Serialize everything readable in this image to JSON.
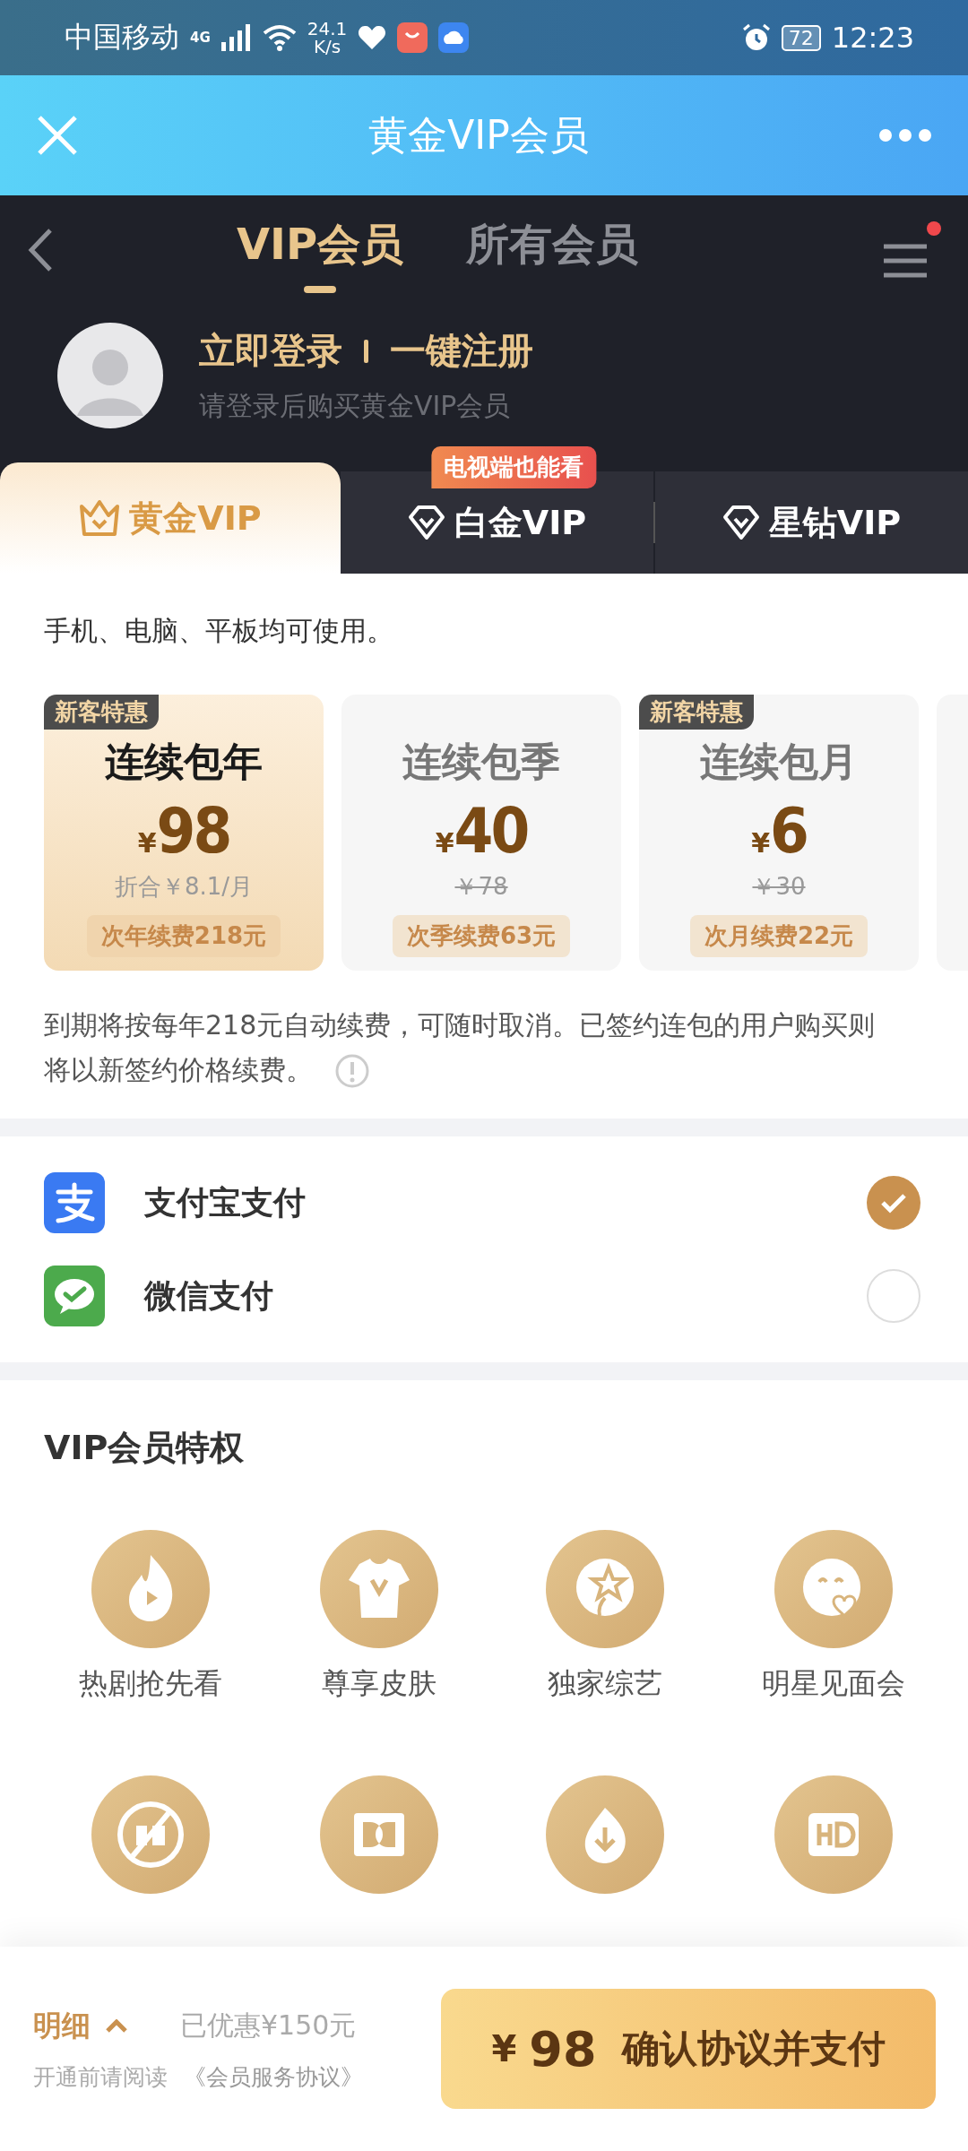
{
  "status_bar": {
    "carrier": "中国移动",
    "network": "4G",
    "speed": "24.1",
    "speed_unit": "K/s",
    "battery": "72",
    "time": "12:23"
  },
  "title_bar": {
    "title": "黄金VIP会员"
  },
  "nav_tabs": [
    {
      "label": "VIP会员",
      "selected": true
    },
    {
      "label": "所有会员",
      "selected": false
    }
  ],
  "login": {
    "login_link": "立即登录",
    "register_link": "一键注册",
    "hint": "请登录后购买黄金VIP会员"
  },
  "tiers": [
    {
      "label": "黄金VIP",
      "kind": "crown",
      "selected": true
    },
    {
      "label": "白金VIP",
      "kind": "diamond",
      "selected": false,
      "badge": "电视端也能看"
    },
    {
      "label": "星钻VIP",
      "kind": "diamond",
      "selected": false
    }
  ],
  "devices_note": "手机、电脑、平板均可使用。",
  "plans": [
    {
      "badge": "新客特惠",
      "title": "连续包年",
      "currency": "¥",
      "price": "98",
      "sub": "折合￥8.1/月",
      "struck": false,
      "renewal": "次年续费218元",
      "selected": true
    },
    {
      "title": "连续包季",
      "currency": "¥",
      "price": "40",
      "sub": "￥78",
      "struck": true,
      "renewal": "次季续费63元",
      "selected": false
    },
    {
      "badge": "新客特惠",
      "title": "连续包月",
      "currency": "¥",
      "price": "6",
      "sub": "￥30",
      "struck": true,
      "renewal": "次月续费22元",
      "selected": false
    },
    {
      "selected": false
    }
  ],
  "renewal_note": "到期将按每年218元自动续费，可随时取消。已签约连包的用户购买则将以新签约价格续费。",
  "payments": [
    {
      "kind": "alipay",
      "label": "支付宝支付",
      "selected": true
    },
    {
      "kind": "wechat",
      "label": "微信支付",
      "selected": false
    }
  ],
  "privileges": {
    "title": "VIP会员特权",
    "items": [
      {
        "kind": "flame",
        "label": "热剧抢先看"
      },
      {
        "kind": "shirt",
        "label": "尊享皮肤"
      },
      {
        "kind": "star",
        "label": "独家综艺"
      },
      {
        "kind": "smile",
        "label": "明星见面会"
      },
      {
        "kind": "no-ads"
      },
      {
        "kind": "dd"
      },
      {
        "kind": "download"
      },
      {
        "kind": "hd"
      }
    ]
  },
  "footer": {
    "details": "明细",
    "discount": "已优惠¥150元",
    "agreement_prefix": "开通前请阅读",
    "agreement_link": "《会员服务协议》",
    "pay_currency": "¥",
    "pay_amount": "98",
    "pay_label": "确认协议并支付"
  }
}
